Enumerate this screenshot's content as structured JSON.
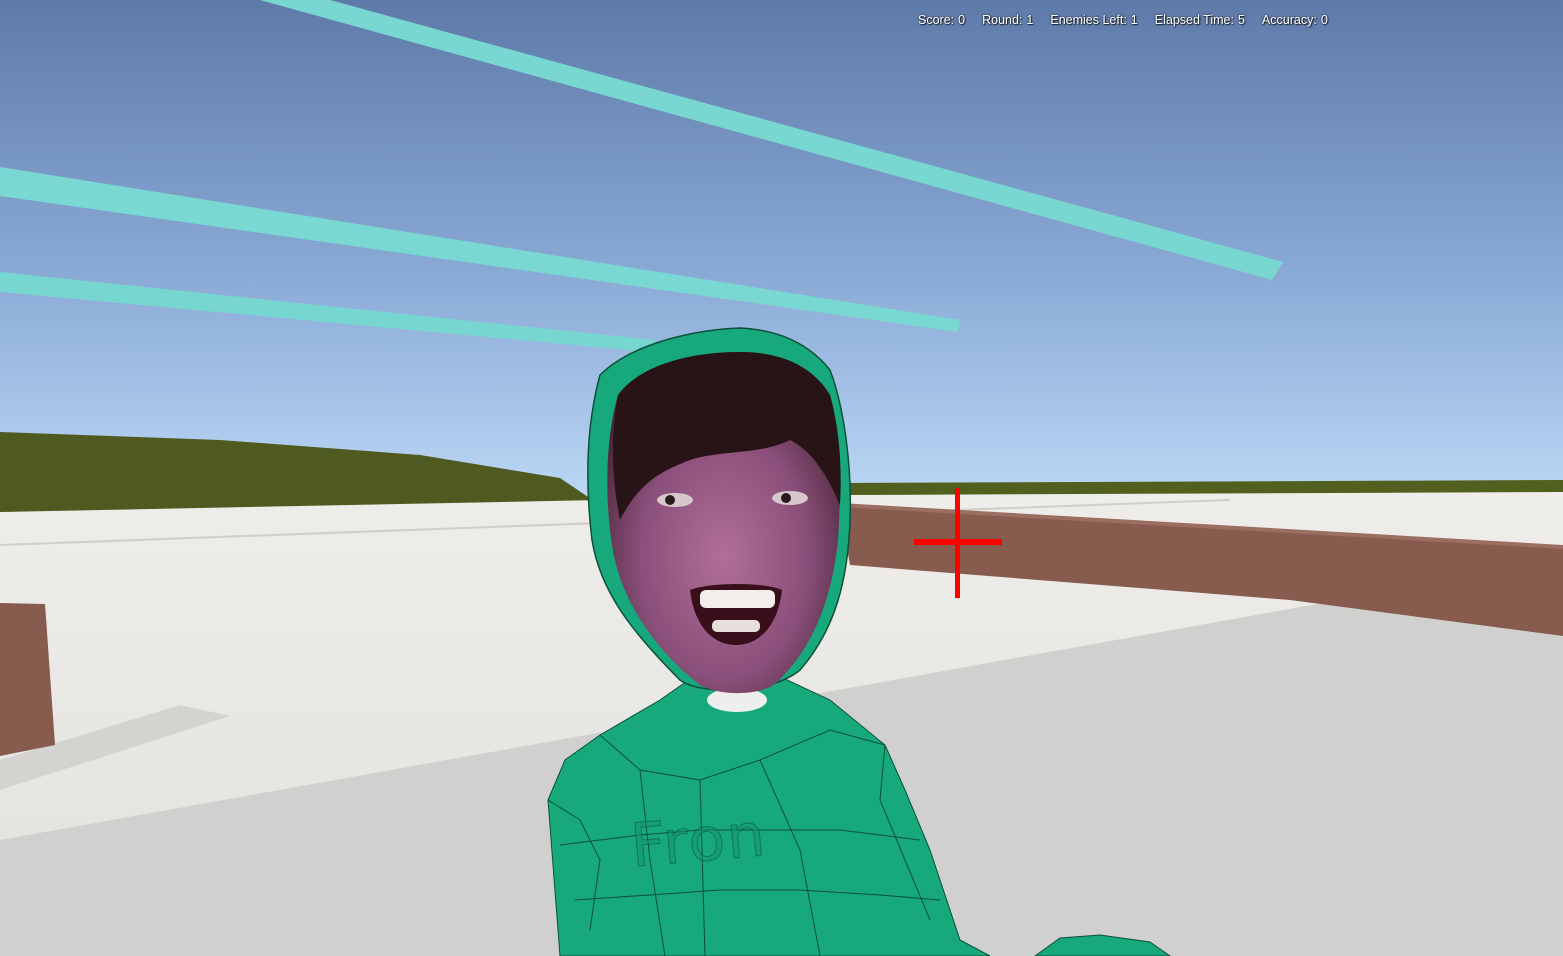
{
  "hud": {
    "score_label": "Score:",
    "score_value": "0",
    "round_label": "Round:",
    "round_value": "1",
    "enemies_label": "Enemies Left:",
    "enemies_value": "1",
    "time_label": "Elapsed Time:",
    "time_value": "5",
    "accuracy_label": "Accuracy:",
    "accuracy_value": "0"
  },
  "enemy": {
    "shirt_text": "Fron"
  },
  "colors": {
    "sky_top": "#5f7aa8",
    "sky_horizon": "#b6d4f4",
    "beam": "#79d7d1",
    "hill": "#4f5a21",
    "ground": "#e6e5e1",
    "wall": "#875b4e",
    "enemy_body": "#17a97c",
    "crosshair": "#ff0000"
  },
  "icons": {
    "crosshair": "crosshair-icon"
  }
}
